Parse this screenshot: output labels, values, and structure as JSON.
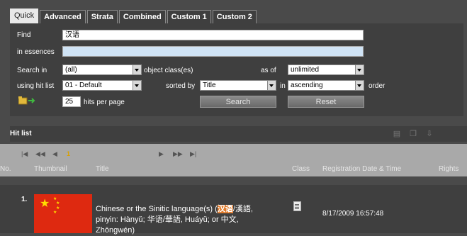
{
  "tabs": [
    "Quick",
    "Advanced",
    "Strata",
    "Combined",
    "Custom 1",
    "Custom 2"
  ],
  "form": {
    "find_label": "Find",
    "find_value": "汉语",
    "essences_label": "in essences",
    "essences_value": "",
    "search_in_label": "Search in",
    "search_in_value": "(all)",
    "object_class_label": "object class(es)",
    "as_of_label": "as of",
    "as_of_value": "unlimited",
    "hit_list_label": "using hit list",
    "hit_list_value": "01 - Default",
    "sorted_by_label": "sorted by",
    "sorted_by_value": "Title",
    "in_label": "in",
    "order_value": "ascending",
    "order_label": "order",
    "hits_value": "25",
    "hits_label": "hits per page",
    "search_button": "Search",
    "reset_button": "Reset"
  },
  "hitlist": {
    "title": "Hit list",
    "page": "1",
    "columns": [
      "No.",
      "Thumbnail",
      "Title",
      "Class",
      "Registration Date & Time",
      "Rights"
    ],
    "rows": [
      {
        "no": "1.",
        "title_pre": "Chinese or the Sinitic language(s) (",
        "title_hl": "汉语",
        "title_post": "/漢語, pinyin: Hànyǔ; 华语/華語, Huáyǔ; or 中文, Zhōngwén)",
        "date": "8/17/2009 16:57:48"
      }
    ]
  },
  "colors": {
    "highlight": "#e07a2a",
    "flag_red": "#de2910",
    "flag_yellow": "#ffde00"
  }
}
